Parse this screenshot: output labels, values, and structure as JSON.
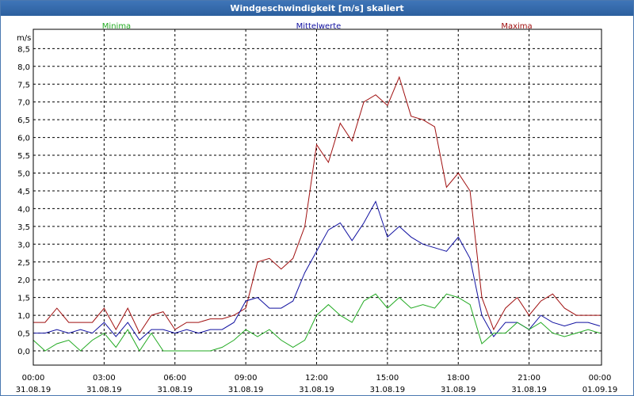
{
  "window": {
    "title": "Windgeschwindigkeit [m/s] skaliert"
  },
  "legend": {
    "min": "Minima",
    "mean": "Mittelwerte",
    "max": "Maxima"
  },
  "colors": {
    "min": "#22aa22",
    "mean": "#1010a0",
    "max": "#a01010",
    "grid": "#000000",
    "frame": "#000000"
  },
  "chart_data": {
    "type": "line",
    "title": "Windgeschwindigkeit [m/s] skaliert",
    "ylabel": "m/s",
    "xlabel": "",
    "ylim": [
      -0.5,
      8.8
    ],
    "y_ticks": [
      "0,0",
      "0,5",
      "1,0",
      "1,5",
      "2,0",
      "2,5",
      "3,0",
      "3,5",
      "4,0",
      "4,5",
      "5,0",
      "5,5",
      "6,0",
      "6,5",
      "7,0",
      "7,5",
      "8,0",
      "8,5"
    ],
    "x_ticks": [
      {
        "time": "00:00",
        "date": "31.08.19"
      },
      {
        "time": "03:00",
        "date": "31.08.19"
      },
      {
        "time": "06:00",
        "date": "31.08.19"
      },
      {
        "time": "09:00",
        "date": "31.08.19"
      },
      {
        "time": "12:00",
        "date": "31.08.19"
      },
      {
        "time": "15:00",
        "date": "31.08.19"
      },
      {
        "time": "18:00",
        "date": "31.08.19"
      },
      {
        "time": "21:00",
        "date": "31.08.19"
      },
      {
        "time": "00:00",
        "date": "01.09.19"
      }
    ],
    "grid": true,
    "x_hours": [
      0,
      0.5,
      1,
      1.5,
      2,
      2.5,
      3,
      3.5,
      4,
      4.5,
      5,
      5.5,
      6,
      6.5,
      7,
      7.5,
      8,
      8.5,
      9,
      9.5,
      10,
      10.5,
      11,
      11.5,
      12,
      12.5,
      13,
      13.5,
      14,
      14.5,
      15,
      15.5,
      16,
      16.5,
      17,
      17.5,
      18,
      18.5,
      19,
      19.5,
      20,
      20.5,
      21,
      21.5,
      22,
      22.5,
      23,
      23.5,
      24
    ],
    "series": [
      {
        "name": "Maxima",
        "values": [
          0.8,
          0.8,
          1.2,
          0.8,
          0.8,
          0.8,
          1.2,
          0.6,
          1.2,
          0.5,
          1.0,
          1.1,
          0.6,
          0.8,
          0.8,
          0.9,
          0.9,
          1.0,
          1.2,
          2.5,
          2.6,
          2.3,
          2.6,
          3.5,
          5.8,
          5.3,
          6.4,
          5.9,
          7.0,
          7.2,
          6.9,
          7.7,
          6.6,
          6.5,
          6.3,
          4.6,
          5.0,
          4.5,
          1.5,
          0.6,
          1.2,
          1.5,
          1.0,
          1.4,
          1.6,
          1.2,
          1.0,
          1.0,
          1.0
        ]
      },
      {
        "name": "Mittelwerte",
        "values": [
          0.5,
          0.5,
          0.6,
          0.5,
          0.6,
          0.5,
          0.8,
          0.4,
          0.8,
          0.3,
          0.6,
          0.6,
          0.5,
          0.6,
          0.5,
          0.6,
          0.6,
          0.8,
          1.4,
          1.5,
          1.2,
          1.2,
          1.4,
          2.2,
          2.8,
          3.4,
          3.6,
          3.1,
          3.6,
          4.2,
          3.2,
          3.5,
          3.2,
          3.0,
          2.9,
          2.8,
          3.2,
          2.6,
          1.0,
          0.4,
          0.8,
          0.8,
          0.6,
          1.0,
          0.8,
          0.7,
          0.8,
          0.8,
          0.7
        ]
      },
      {
        "name": "Minima",
        "values": [
          0.3,
          0.0,
          0.2,
          0.3,
          0.0,
          0.3,
          0.5,
          0.1,
          0.6,
          0.0,
          0.5,
          0.0,
          0.0,
          0.0,
          0.0,
          0.0,
          0.1,
          0.3,
          0.6,
          0.4,
          0.6,
          0.3,
          0.1,
          0.3,
          1.0,
          1.3,
          1.0,
          0.8,
          1.4,
          1.6,
          1.2,
          1.5,
          1.2,
          1.3,
          1.2,
          1.6,
          1.5,
          1.3,
          0.2,
          0.5,
          0.5,
          0.8,
          0.6,
          0.8,
          0.5,
          0.4,
          0.5,
          0.6,
          0.5
        ]
      }
    ]
  }
}
